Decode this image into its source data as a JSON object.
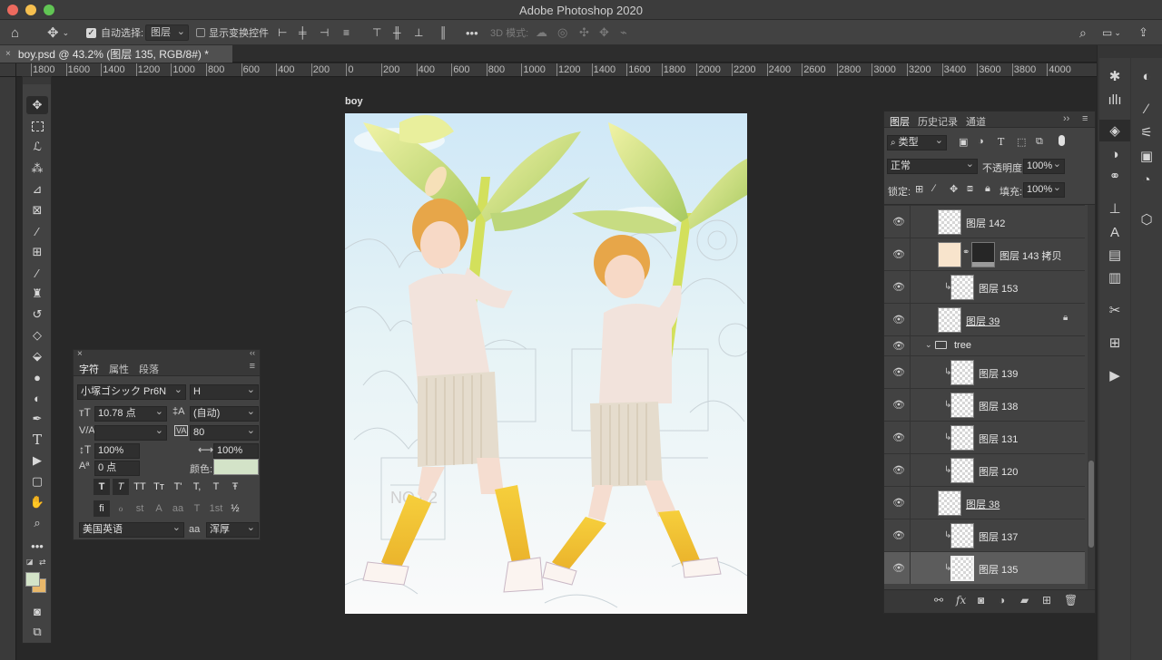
{
  "window": {
    "title": "Adobe Photoshop 2020"
  },
  "options_bar": {
    "auto_select_label": "自动选择:",
    "auto_select_target": "图层",
    "show_transform_label": "显示变换控件",
    "mode_3d_label": "3D 模式:"
  },
  "document": {
    "tab_title": "boy.psd @ 43.2% (图层 135, RGB/8#) *",
    "canvas_label": "boy",
    "ruler_ticks": [
      "1800",
      "1600",
      "1400",
      "1200",
      "1000",
      "800",
      "600",
      "400",
      "200",
      "0",
      "200",
      "400",
      "600",
      "800",
      "1000",
      "1200",
      "1400",
      "1600",
      "1800",
      "2000",
      "2200",
      "2400",
      "2600",
      "2800",
      "3000",
      "3200",
      "3400",
      "3600",
      "3800",
      "4000"
    ]
  },
  "character_panel": {
    "tabs": [
      "字符",
      "属性",
      "段落"
    ],
    "font_family": "小塚ゴシック Pr6N",
    "font_style": "H",
    "font_size": "10.78 点",
    "leading": "(自动)",
    "kerning": "",
    "tracking": "80",
    "vertical_scale": "100%",
    "horizontal_scale": "100%",
    "baseline_shift": "0 点",
    "color_label": "颜色:",
    "language": "美国英语",
    "antialias_label": "aa",
    "antialias": "浑厚",
    "style_buttons_row1": [
      "T",
      "T",
      "TT",
      "Tт",
      "T'",
      "T,",
      "T",
      "Ŧ"
    ],
    "style_buttons_row2": [
      "fi",
      "ℴ",
      "st",
      "A",
      "aa",
      "T",
      "1st",
      "½"
    ]
  },
  "layers_panel": {
    "tabs": [
      "图层",
      "历史记录",
      "通道"
    ],
    "filter_kind": "类型",
    "blend_mode": "正常",
    "opacity_label": "不透明度:",
    "opacity": "100%",
    "lock_label": "锁定:",
    "fill_label": "填充:",
    "fill": "100%",
    "layers": [
      {
        "name": "图层 142",
        "clipped": false,
        "kind": "pixel"
      },
      {
        "name": "图层 143 拷贝",
        "clipped": false,
        "kind": "masked"
      },
      {
        "name": "图层 153",
        "clipped": true,
        "kind": "pixel"
      },
      {
        "name": "图层 39",
        "clipped": false,
        "kind": "locked"
      },
      {
        "name": "tree",
        "clipped": false,
        "kind": "group"
      },
      {
        "name": "图层 139",
        "clipped": true,
        "kind": "pixel"
      },
      {
        "name": "图层 138",
        "clipped": true,
        "kind": "pixel"
      },
      {
        "name": "图层 131",
        "clipped": true,
        "kind": "pixel"
      },
      {
        "name": "图层 120",
        "clipped": true,
        "kind": "pixel"
      },
      {
        "name": "图层 38",
        "clipped": false,
        "kind": "pixel"
      },
      {
        "name": "图层 137",
        "clipped": true,
        "kind": "pixel"
      },
      {
        "name": "图层 135",
        "clipped": true,
        "kind": "pixel",
        "selected": true
      }
    ]
  },
  "colors": {
    "foreground": "#d3e3c8",
    "background": "#e9b86a",
    "accent": "#3d7bd8"
  }
}
